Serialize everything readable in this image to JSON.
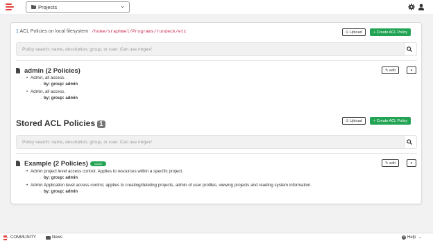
{
  "header": {
    "project_select": "Projects",
    "settings_icon": "gear-icon",
    "user_icon": "user-icon"
  },
  "filesystem": {
    "count": "1",
    "label": "ACL Policies on local filesystem",
    "path": "/home/sraphmel/Programs/rundeck/etc",
    "upload_label": "Upload",
    "create_label": "Create ACL Policy",
    "search_placeholder": "Policy search: name, description, group, or user. Can use /regex/",
    "policy": {
      "title": "admin (2 Policies)",
      "edit_label": "edit",
      "rules": [
        {
          "description": "Admin, all access.",
          "by": "by: group: admin"
        },
        {
          "description": "Admin, all access.",
          "by": "by: group: admin"
        }
      ]
    }
  },
  "stored": {
    "title": "Stored ACL Policies",
    "count": "1",
    "upload_label": "Upload",
    "create_label": "Create ACL Policy",
    "search_placeholder": "Policy search: name, description, group, or user. Can use /regex/",
    "policy": {
      "title": "Example (2 Policies)",
      "badge": "VALID",
      "edit_label": "edit",
      "rules": [
        {
          "description": "Admin project level access control. Applies to resources within a specific project.",
          "by": "by: group: admin"
        },
        {
          "description": "Admin Application level access control, applies to creating/deleting projects, admin of user profiles, viewing projects and reading system information.",
          "by": "by: group: admin"
        }
      ]
    }
  },
  "footer": {
    "community": "COMMUNITY",
    "news": "News",
    "help": "Help"
  },
  "colors": {
    "accent_green": "#23a454",
    "brand_red": "#e0403a",
    "path_color": "#c7254e"
  }
}
